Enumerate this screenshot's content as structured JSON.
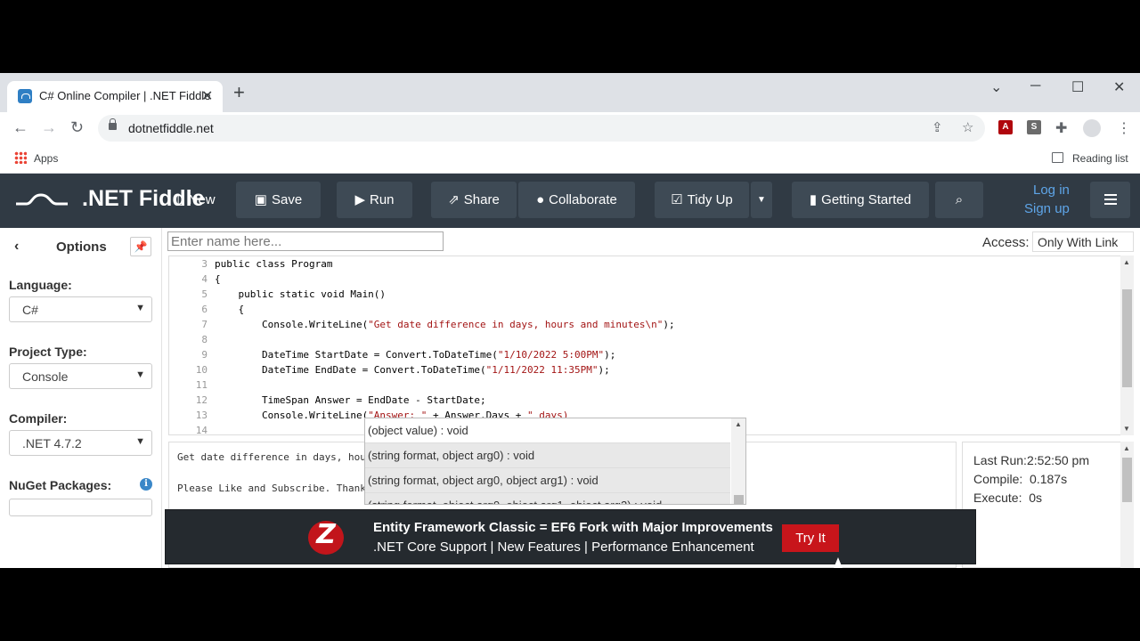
{
  "browser": {
    "tab_title": "C# Online Compiler | .NET Fiddle",
    "tab_close": "✕",
    "new_tab": "+",
    "url": "dotnetfiddle.net",
    "bookmarks_apps": "Apps",
    "reading_list": "Reading list"
  },
  "navbar": {
    "logo": ".NET Fiddle",
    "new_label": "New",
    "save_label": "Save",
    "run_label": "Run",
    "share_label": "Share",
    "collaborate_label": "Collaborate",
    "tidy_label": "Tidy Up",
    "getting_started_label": "Getting Started",
    "login_label": "Log in",
    "signup_label": "Sign up"
  },
  "sidebar": {
    "title": "Options",
    "language_label": "Language:",
    "language_value": "C#",
    "project_type_label": "Project Type:",
    "project_type_value": "Console",
    "compiler_label": "Compiler:",
    "compiler_value": ".NET 4.7.2",
    "nuget_label": "NuGet Packages:"
  },
  "fiddle": {
    "name_placeholder": "Enter name here...",
    "access_label": "Access:",
    "access_value": "Only With Link"
  },
  "editor": {
    "lines": [
      {
        "n": "3",
        "code": "public class Program"
      },
      {
        "n": "4",
        "code": "{"
      },
      {
        "n": "5",
        "code": "    public static void Main()"
      },
      {
        "n": "6",
        "code": "    {"
      },
      {
        "n": "7",
        "pre": "        Console.WriteLine(",
        "str": "\"Get date difference in days, hours and minutes\\n\"",
        "post": ");"
      },
      {
        "n": "8",
        "code": ""
      },
      {
        "n": "9",
        "pre": "        DateTime StartDate = Convert.ToDateTime(",
        "str": "\"1/10/2022 5:00PM\"",
        "post": ");"
      },
      {
        "n": "10",
        "pre": "        DateTime EndDate = Convert.ToDateTime(",
        "str": "\"1/11/2022 11:35PM\"",
        "post": ");"
      },
      {
        "n": "11",
        "code": ""
      },
      {
        "n": "12",
        "code": "        TimeSpan Answer = EndDate - StartDate;"
      },
      {
        "n": "13",
        "pre": "        Console.WriteLine(",
        "str": "\"Answer: \"",
        "post": " + Answer.Days + ",
        "str2": "\" days)"
      },
      {
        "n": "14",
        "code": ""
      }
    ]
  },
  "autocomplete": {
    "items": [
      "(object value) : void",
      "(string format, object arg0) : void",
      "(string format, object arg0, object arg1) : void",
      "(string format, object arg0, object arg1, object arg2) : void"
    ]
  },
  "output": {
    "line1": "Get date difference in days, hou",
    "line2": "Please Like and Subscribe. Thank"
  },
  "stats": {
    "last_run_label": "Last Run:",
    "last_run_value": "2:52:50 pm",
    "compile_label": "Compile:",
    "compile_value": "0.187s",
    "execute_label": "Execute:",
    "execute_value": "0s"
  },
  "ad": {
    "title": "Entity Framework Classic = EF6 Fork with Major Improvements",
    "subtitle": ".NET Core Support | New Features | Performance Enhancement",
    "button": "Try It"
  },
  "colors": {
    "navbar_bg": "#303a44",
    "link": "#5ea5e8",
    "ad_accent": "#c8151b"
  }
}
